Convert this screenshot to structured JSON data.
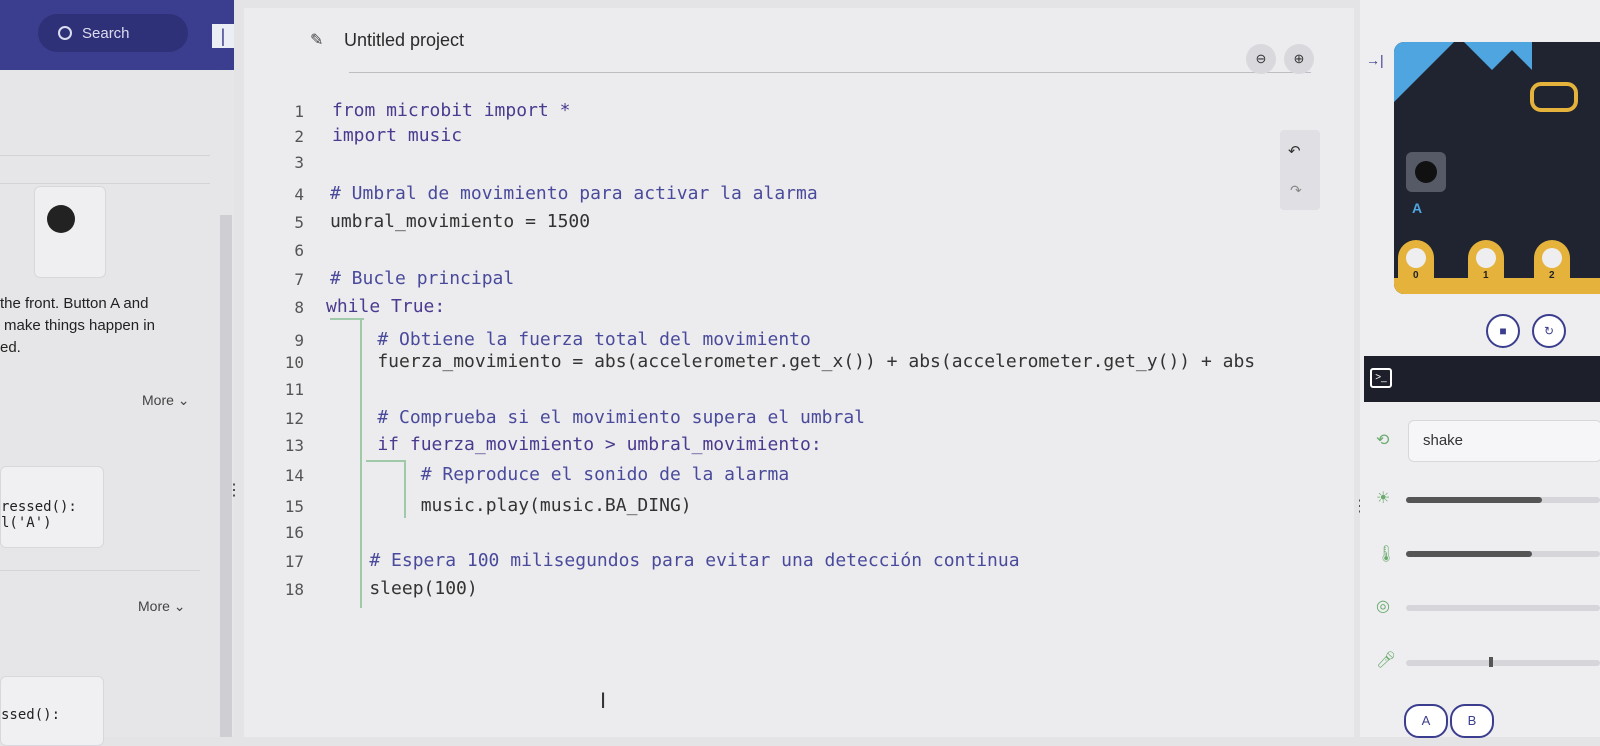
{
  "sidebar": {
    "search_label": "Search",
    "collapse_glyph": "|←",
    "reference_text": [
      "the front. Button A and",
      "make things happen in",
      "ed."
    ],
    "more_label_1": "More ⌄",
    "code_snippet_1": [
      "ressed():",
      "l('A')"
    ],
    "more_label_2": "More ⌄",
    "code_snippet_2": "ssed():"
  },
  "editor": {
    "project_title": "Untitled project",
    "zoom_out_label": "🔍︎",
    "zoom_in_label": "🔍︎",
    "undo_glyph": "↶",
    "redo_glyph": "↷",
    "code_lines": [
      "from microbit import *",
      "import music",
      "",
      "# Umbral de movimiento para activar la alarma",
      "umbral_movimiento = 1500",
      "",
      "# Bucle principal",
      "while True:",
      "    # Obtiene la fuerza total del movimiento",
      "    fuerza_movimiento = abs(accelerometer.get_x()) + abs(accelerometer.get_y()) + abs",
      "",
      "    # Comprueba si el movimiento supera el umbral",
      "    if fuerza_movimiento > umbral_movimiento:",
      "        # Reproduce el sonido de la alarma",
      "        music.play(music.BA_DING)",
      "",
      "    # Espera 100 milisegundos para evitar una detección continua",
      "    sleep(100)"
    ],
    "line_numbers": [
      "1",
      "2",
      "3",
      "4",
      "5",
      "6",
      "7",
      "8",
      "9",
      "10",
      "11",
      "12",
      "13",
      "14",
      "15",
      "16",
      "17",
      "18"
    ]
  },
  "simulator": {
    "collapse_glyph": "→|",
    "board_button_label": "A",
    "pin_labels": [
      "0",
      "1",
      "2"
    ],
    "stop_glyph": "■",
    "restart_glyph": "↻",
    "serial_glyph": ">_",
    "gesture_value": "shake",
    "brightness_level": 0.7,
    "temperature_level": 0.65,
    "sound_level": 0.43,
    "button_a_label": "A",
    "button_b_label": "B"
  },
  "colors": {
    "brand": "#3b3d8e",
    "keyword": "#4b3a8f",
    "comment": "#4a4a9c",
    "board_blue": "#4fa5df",
    "board_gold": "#e5b23b"
  }
}
